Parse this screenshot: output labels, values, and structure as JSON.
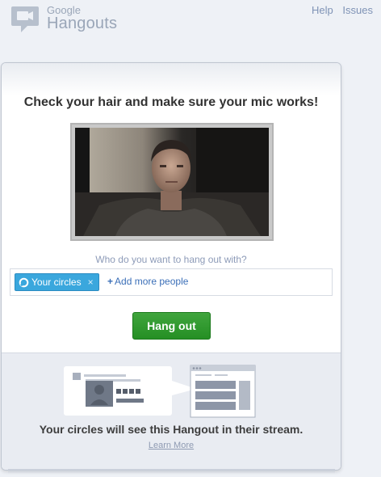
{
  "header": {
    "logo_google": "Google",
    "logo_hangouts": "Hangouts",
    "links": {
      "help": "Help",
      "issues": "Issues"
    }
  },
  "main": {
    "headline": "Check your hair and make sure your mic works!",
    "question": "Who do you want to hang out with?",
    "chip_label": "Your circles",
    "chip_remove": "×",
    "add_more_plus": "+",
    "add_more_label": "Add more people",
    "hangout_button": "Hang out"
  },
  "footer": {
    "stream_text": "Your circles will see this Hangout in their stream.",
    "learn_more": "Learn More"
  },
  "icons": {
    "logo": "hangouts-video-icon",
    "chip": "circles-icon",
    "add": "plus-icon"
  },
  "colors": {
    "accent": "#3aa7dd",
    "button_green": "#2f9a2e",
    "link_blue": "#3b6fb8"
  }
}
